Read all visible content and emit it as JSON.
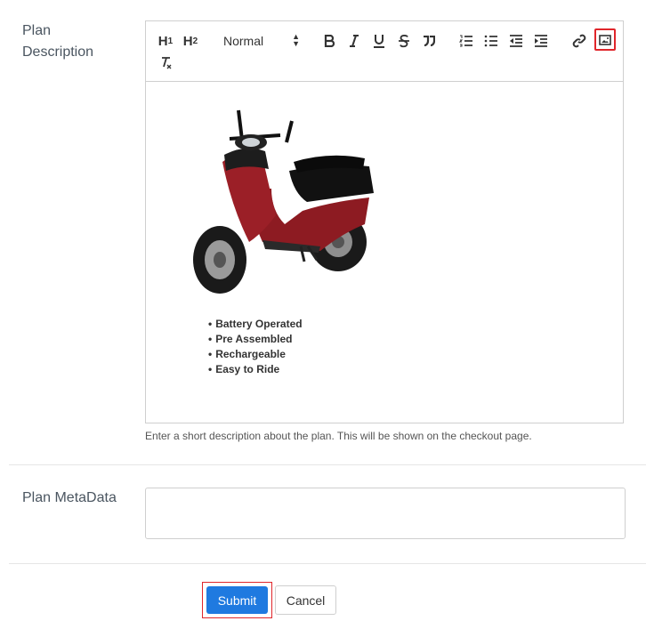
{
  "plan_description": {
    "label_line1": "Plan",
    "label_line2": "Description",
    "hint": "Enter a short description about the plan. This will be shown on the checkout page."
  },
  "toolbar": {
    "h1": "H",
    "h1_sub": "1",
    "h2": "H",
    "h2_sub": "2",
    "format_select": "Normal",
    "icons": [
      "heading-1",
      "heading-2",
      "format-select",
      "bold",
      "italic",
      "underline",
      "strikethrough",
      "blockquote",
      "ordered-list",
      "bullet-list",
      "outdent",
      "indent",
      "link",
      "image",
      "clear-format"
    ],
    "highlight_color": "#e0262b"
  },
  "editor": {
    "bullets": [
      "Battery Operated",
      "Pre Assembled",
      "Rechargeable",
      "Easy to Ride"
    ]
  },
  "plan_metadata": {
    "label": "Plan MetaData",
    "value": ""
  },
  "actions": {
    "submit": "Submit",
    "cancel": "Cancel",
    "primary_color": "#1f7ae0"
  }
}
